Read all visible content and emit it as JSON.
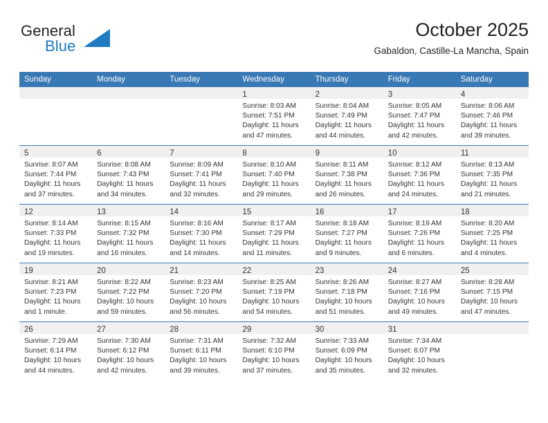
{
  "brand": {
    "word1": "General",
    "word2": "Blue",
    "triangle_color": "#1f7bc1",
    "word1_color": "#231f20",
    "word2_color": "#1f7bc1",
    "logo_icon": "triangle-logo-icon"
  },
  "header": {
    "title": "October 2025",
    "subtitle": "Gabaldon, Castille-La Mancha, Spain"
  },
  "colors": {
    "header_row_bg": "#3878b4",
    "header_row_text": "#ffffff",
    "daynum_band_bg": "#f0f0f0",
    "cell_text": "#333333",
    "row_border": "#3878b4"
  },
  "weekdays": [
    "Sunday",
    "Monday",
    "Tuesday",
    "Wednesday",
    "Thursday",
    "Friday",
    "Saturday"
  ],
  "weeks": [
    [
      {
        "day": "",
        "empty": true,
        "line1": "",
        "line2": "",
        "line3": "",
        "line4": ""
      },
      {
        "day": "",
        "empty": true,
        "line1": "",
        "line2": "",
        "line3": "",
        "line4": ""
      },
      {
        "day": "",
        "empty": true,
        "line1": "",
        "line2": "",
        "line3": "",
        "line4": ""
      },
      {
        "day": "1",
        "empty": false,
        "line1": "Sunrise: 8:03 AM",
        "line2": "Sunset: 7:51 PM",
        "line3": "Daylight: 11 hours",
        "line4": "and 47 minutes."
      },
      {
        "day": "2",
        "empty": false,
        "line1": "Sunrise: 8:04 AM",
        "line2": "Sunset: 7:49 PM",
        "line3": "Daylight: 11 hours",
        "line4": "and 44 minutes."
      },
      {
        "day": "3",
        "empty": false,
        "line1": "Sunrise: 8:05 AM",
        "line2": "Sunset: 7:47 PM",
        "line3": "Daylight: 11 hours",
        "line4": "and 42 minutes."
      },
      {
        "day": "4",
        "empty": false,
        "line1": "Sunrise: 8:06 AM",
        "line2": "Sunset: 7:46 PM",
        "line3": "Daylight: 11 hours",
        "line4": "and 39 minutes."
      }
    ],
    [
      {
        "day": "5",
        "empty": false,
        "line1": "Sunrise: 8:07 AM",
        "line2": "Sunset: 7:44 PM",
        "line3": "Daylight: 11 hours",
        "line4": "and 37 minutes."
      },
      {
        "day": "6",
        "empty": false,
        "line1": "Sunrise: 8:08 AM",
        "line2": "Sunset: 7:43 PM",
        "line3": "Daylight: 11 hours",
        "line4": "and 34 minutes."
      },
      {
        "day": "7",
        "empty": false,
        "line1": "Sunrise: 8:09 AM",
        "line2": "Sunset: 7:41 PM",
        "line3": "Daylight: 11 hours",
        "line4": "and 32 minutes."
      },
      {
        "day": "8",
        "empty": false,
        "line1": "Sunrise: 8:10 AM",
        "line2": "Sunset: 7:40 PM",
        "line3": "Daylight: 11 hours",
        "line4": "and 29 minutes."
      },
      {
        "day": "9",
        "empty": false,
        "line1": "Sunrise: 8:11 AM",
        "line2": "Sunset: 7:38 PM",
        "line3": "Daylight: 11 hours",
        "line4": "and 26 minutes."
      },
      {
        "day": "10",
        "empty": false,
        "line1": "Sunrise: 8:12 AM",
        "line2": "Sunset: 7:36 PM",
        "line3": "Daylight: 11 hours",
        "line4": "and 24 minutes."
      },
      {
        "day": "11",
        "empty": false,
        "line1": "Sunrise: 8:13 AM",
        "line2": "Sunset: 7:35 PM",
        "line3": "Daylight: 11 hours",
        "line4": "and 21 minutes."
      }
    ],
    [
      {
        "day": "12",
        "empty": false,
        "line1": "Sunrise: 8:14 AM",
        "line2": "Sunset: 7:33 PM",
        "line3": "Daylight: 11 hours",
        "line4": "and 19 minutes."
      },
      {
        "day": "13",
        "empty": false,
        "line1": "Sunrise: 8:15 AM",
        "line2": "Sunset: 7:32 PM",
        "line3": "Daylight: 11 hours",
        "line4": "and 16 minutes."
      },
      {
        "day": "14",
        "empty": false,
        "line1": "Sunrise: 8:16 AM",
        "line2": "Sunset: 7:30 PM",
        "line3": "Daylight: 11 hours",
        "line4": "and 14 minutes."
      },
      {
        "day": "15",
        "empty": false,
        "line1": "Sunrise: 8:17 AM",
        "line2": "Sunset: 7:29 PM",
        "line3": "Daylight: 11 hours",
        "line4": "and 11 minutes."
      },
      {
        "day": "16",
        "empty": false,
        "line1": "Sunrise: 8:18 AM",
        "line2": "Sunset: 7:27 PM",
        "line3": "Daylight: 11 hours",
        "line4": "and 9 minutes."
      },
      {
        "day": "17",
        "empty": false,
        "line1": "Sunrise: 8:19 AM",
        "line2": "Sunset: 7:26 PM",
        "line3": "Daylight: 11 hours",
        "line4": "and 6 minutes."
      },
      {
        "day": "18",
        "empty": false,
        "line1": "Sunrise: 8:20 AM",
        "line2": "Sunset: 7:25 PM",
        "line3": "Daylight: 11 hours",
        "line4": "and 4 minutes."
      }
    ],
    [
      {
        "day": "19",
        "empty": false,
        "line1": "Sunrise: 8:21 AM",
        "line2": "Sunset: 7:23 PM",
        "line3": "Daylight: 11 hours",
        "line4": "and 1 minute."
      },
      {
        "day": "20",
        "empty": false,
        "line1": "Sunrise: 8:22 AM",
        "line2": "Sunset: 7:22 PM",
        "line3": "Daylight: 10 hours",
        "line4": "and 59 minutes."
      },
      {
        "day": "21",
        "empty": false,
        "line1": "Sunrise: 8:23 AM",
        "line2": "Sunset: 7:20 PM",
        "line3": "Daylight: 10 hours",
        "line4": "and 56 minutes."
      },
      {
        "day": "22",
        "empty": false,
        "line1": "Sunrise: 8:25 AM",
        "line2": "Sunset: 7:19 PM",
        "line3": "Daylight: 10 hours",
        "line4": "and 54 minutes."
      },
      {
        "day": "23",
        "empty": false,
        "line1": "Sunrise: 8:26 AM",
        "line2": "Sunset: 7:18 PM",
        "line3": "Daylight: 10 hours",
        "line4": "and 51 minutes."
      },
      {
        "day": "24",
        "empty": false,
        "line1": "Sunrise: 8:27 AM",
        "line2": "Sunset: 7:16 PM",
        "line3": "Daylight: 10 hours",
        "line4": "and 49 minutes."
      },
      {
        "day": "25",
        "empty": false,
        "line1": "Sunrise: 8:28 AM",
        "line2": "Sunset: 7:15 PM",
        "line3": "Daylight: 10 hours",
        "line4": "and 47 minutes."
      }
    ],
    [
      {
        "day": "26",
        "empty": false,
        "line1": "Sunrise: 7:29 AM",
        "line2": "Sunset: 6:14 PM",
        "line3": "Daylight: 10 hours",
        "line4": "and 44 minutes."
      },
      {
        "day": "27",
        "empty": false,
        "line1": "Sunrise: 7:30 AM",
        "line2": "Sunset: 6:12 PM",
        "line3": "Daylight: 10 hours",
        "line4": "and 42 minutes."
      },
      {
        "day": "28",
        "empty": false,
        "line1": "Sunrise: 7:31 AM",
        "line2": "Sunset: 6:11 PM",
        "line3": "Daylight: 10 hours",
        "line4": "and 39 minutes."
      },
      {
        "day": "29",
        "empty": false,
        "line1": "Sunrise: 7:32 AM",
        "line2": "Sunset: 6:10 PM",
        "line3": "Daylight: 10 hours",
        "line4": "and 37 minutes."
      },
      {
        "day": "30",
        "empty": false,
        "line1": "Sunrise: 7:33 AM",
        "line2": "Sunset: 6:09 PM",
        "line3": "Daylight: 10 hours",
        "line4": "and 35 minutes."
      },
      {
        "day": "31",
        "empty": false,
        "line1": "Sunrise: 7:34 AM",
        "line2": "Sunset: 6:07 PM",
        "line3": "Daylight: 10 hours",
        "line4": "and 32 minutes."
      },
      {
        "day": "",
        "empty": true,
        "line1": "",
        "line2": "",
        "line3": "",
        "line4": ""
      }
    ]
  ]
}
